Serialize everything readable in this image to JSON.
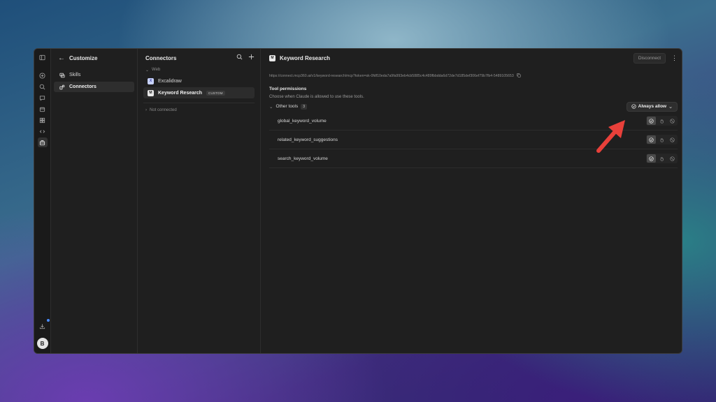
{
  "nav": {
    "title": "Customize",
    "items": [
      {
        "label": "Skills",
        "icon": "skills-icon",
        "active": false
      },
      {
        "label": "Connectors",
        "icon": "connectors-icon",
        "active": true
      }
    ]
  },
  "rail": {
    "avatar_initial": "B"
  },
  "connectors": {
    "title": "Connectors",
    "group_web": "Web",
    "items": [
      {
        "label": "Excalidraw",
        "icon_text": "X",
        "active": false
      },
      {
        "label": "Keyword Research",
        "icon_text": "M",
        "active": true,
        "tag": "CUSTOM"
      }
    ],
    "not_connected": "Not connected"
  },
  "main": {
    "title": "Keyword Research",
    "title_icon_text": "M",
    "disconnect_label": "Disconnect",
    "url": "https://connect.mcp360.ai/v1/keyword-research/mcp?token=sk-0fdf10eda7a9fa993eb4cb5885c4c489fbbdda6d72de7d185def306ef79b7fb4-5489105653",
    "permissions_title": "Tool permissions",
    "permissions_desc": "Choose when Claude is allowed to use these tools.",
    "group_label": "Other tools",
    "group_count": "3",
    "allow_label": "Always allow",
    "tools": [
      {
        "name": "global_keyword_volume"
      },
      {
        "name": "related_keyword_suggestions"
      },
      {
        "name": "search_keyword_volume"
      }
    ]
  },
  "colors": {
    "annotation_arrow": "#e8403a",
    "window_bg": "#1f1f1f"
  }
}
